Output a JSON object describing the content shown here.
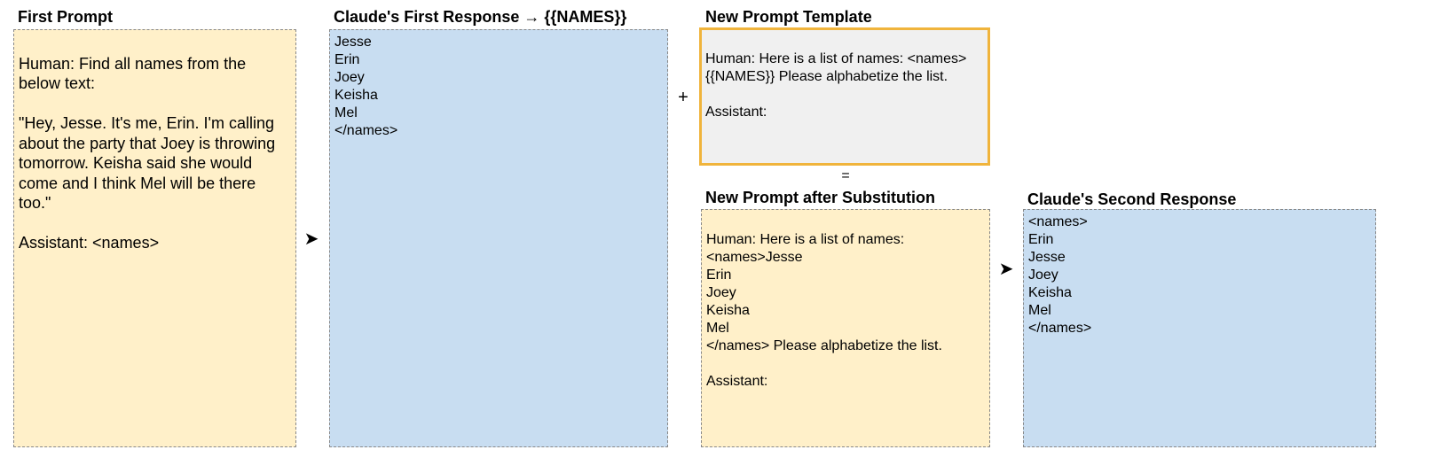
{
  "first_prompt": {
    "title": "First Prompt",
    "text": "\nHuman: Find all names from the below text:\n\n\"Hey, Jesse. It's me, Erin. I'm calling about the party that Joey is throwing tomorrow. Keisha said she would come and I think Mel will be there too.\"\n\nAssistant: <names>"
  },
  "first_response": {
    "title": "Claude's First Response → {{NAMES}}",
    "text": "Jesse\nErin\nJoey\nKeisha\nMel\n</names>"
  },
  "template": {
    "title": "New Prompt Template",
    "text": "\nHuman: Here is a list of names: <names>{{NAMES}} Please alphabetize the list.\n\nAssistant:"
  },
  "substituted": {
    "title": "New Prompt after Substitution",
    "text": "\nHuman: Here is a list of names: <names>Jesse\nErin\nJoey\nKeisha\nMel\n</names> Please alphabetize the list.\n\nAssistant:"
  },
  "second_response": {
    "title": "Claude's Second Response",
    "text": "<names>\nErin\nJesse\nJoey\nKeisha\nMel\n</names>"
  },
  "symbols": {
    "arrow": "➤",
    "plus": "+",
    "equals": "="
  }
}
